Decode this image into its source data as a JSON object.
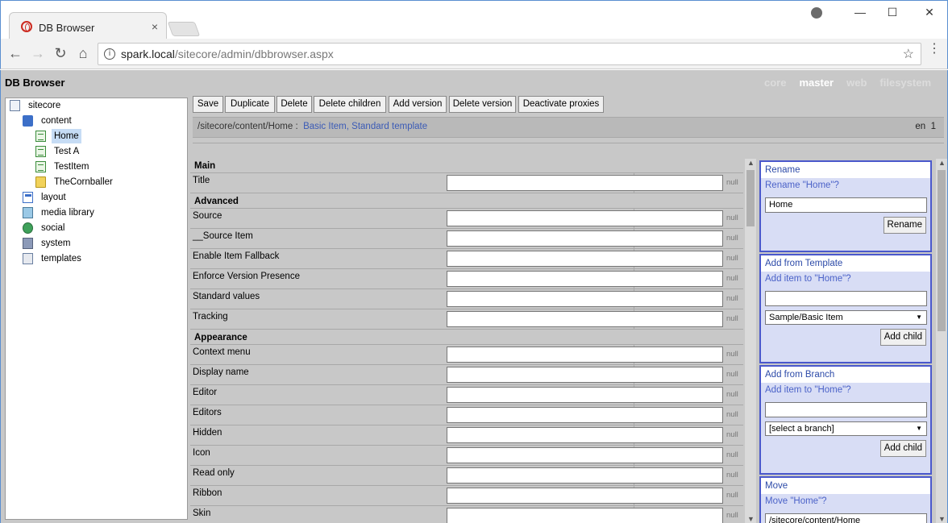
{
  "browser": {
    "tab_title": "DB Browser",
    "tab_close": "×",
    "url_host": "spark.local",
    "url_path": "/sitecore/admin/dbbrowser.aspx",
    "win_minimize": "—",
    "win_maximize": "☐",
    "win_close": "✕",
    "back": "←",
    "forward": "→",
    "reload": "↻",
    "home": "⌂",
    "info": "i",
    "star": "☆",
    "menu": "⋮"
  },
  "app": {
    "title": "DB Browser",
    "databases": [
      {
        "name": "core",
        "active": false
      },
      {
        "name": "master",
        "active": true
      },
      {
        "name": "web",
        "active": false
      },
      {
        "name": "filesystem",
        "active": false
      }
    ]
  },
  "tree": [
    {
      "label": "sitecore",
      "icon": "document-icon"
    },
    {
      "label": "content",
      "icon": "cubes-icon"
    },
    {
      "label": "Home",
      "icon": "page-icon",
      "selected": true
    },
    {
      "label": "Test A",
      "icon": "page-icon"
    },
    {
      "label": "TestItem",
      "icon": "page-icon"
    },
    {
      "label": "TheCornballer",
      "icon": "folder-icon"
    },
    {
      "label": "layout",
      "icon": "layout-icon"
    },
    {
      "label": "media library",
      "icon": "media-icon"
    },
    {
      "label": "social",
      "icon": "globe-icon"
    },
    {
      "label": "system",
      "icon": "system-icon"
    },
    {
      "label": "templates",
      "icon": "templates-icon"
    }
  ],
  "buttons": [
    "Save",
    "Duplicate",
    "Delete",
    "Delete children",
    "Add version",
    "Delete version",
    "Deactivate proxies"
  ],
  "path": {
    "item_path": "/sitecore/content/Home",
    "separator": ":",
    "template": "Basic Item",
    "comma": ",",
    "standard": "Standard template",
    "language": "en",
    "version": "1"
  },
  "fields": {
    "null_label": "null",
    "sections": [
      {
        "title": "Main",
        "fields": [
          "Title"
        ]
      },
      {
        "title": "Advanced",
        "fields": [
          "Source",
          "__Source Item",
          "Enable Item Fallback",
          "Enforce Version Presence",
          "Standard values",
          "Tracking"
        ]
      },
      {
        "title": "Appearance",
        "fields": [
          "Context menu",
          "Display name",
          "Editor",
          "Editors",
          "Hidden",
          "Icon",
          "Read only",
          "Ribbon",
          "Skin"
        ]
      }
    ]
  },
  "panels": {
    "rename": {
      "header": "Rename",
      "question": "Rename \"Home\"?",
      "value": "Home",
      "button": "Rename"
    },
    "add_template": {
      "header": "Add from Template",
      "question": "Add item to \"Home\"?",
      "value": "",
      "select": "Sample/Basic Item",
      "button": "Add child"
    },
    "add_branch": {
      "header": "Add from Branch",
      "question": "Add item to \"Home\"?",
      "value": "",
      "select": "[select a branch]",
      "button": "Add child"
    },
    "move": {
      "header": "Move",
      "question": "Move \"Home\"?",
      "value": "/sitecore/content/Home"
    }
  },
  "scroll": {
    "up": "▲",
    "down": "▼",
    "select_arrow": "▼"
  }
}
